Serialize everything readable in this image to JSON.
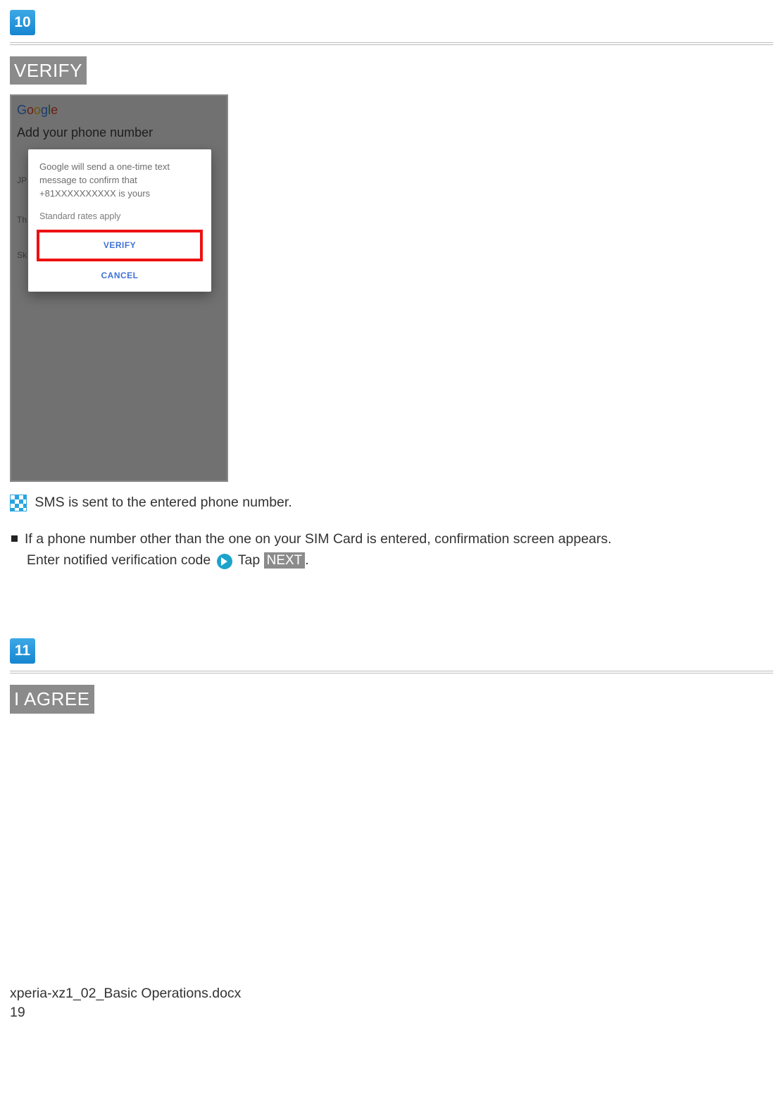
{
  "step10": {
    "num": "10",
    "title": "VERIFY"
  },
  "phone": {
    "logo": {
      "g1": "G",
      "o1": "o",
      "o2": "o",
      "g2": "g",
      "l": "l",
      "e": "e"
    },
    "heading": "Add your phone number",
    "bgJP": "JP",
    "bgTh": "Th",
    "bgSk": "Sk",
    "modal": {
      "l1": "Google will send a one-time text",
      "l2": "message to confirm that",
      "l3": "+81XXXXXXXXXX is yours",
      "rates": "Standard rates apply",
      "verify": "VERIFY",
      "cancel": "CANCEL"
    }
  },
  "result": "SMS is sent to the entered phone number.",
  "bullet": {
    "line1": "If a phone number other than the one on your SIM Card is entered, confirmation screen appears.",
    "line2a": "Enter notified verification code",
    "line2b": "Tap",
    "next": "NEXT",
    "period": "."
  },
  "step11": {
    "num": "11",
    "title": "I AGREE"
  },
  "footer": {
    "file": "xperia-xz1_02_Basic Operations.docx",
    "page": "19"
  }
}
